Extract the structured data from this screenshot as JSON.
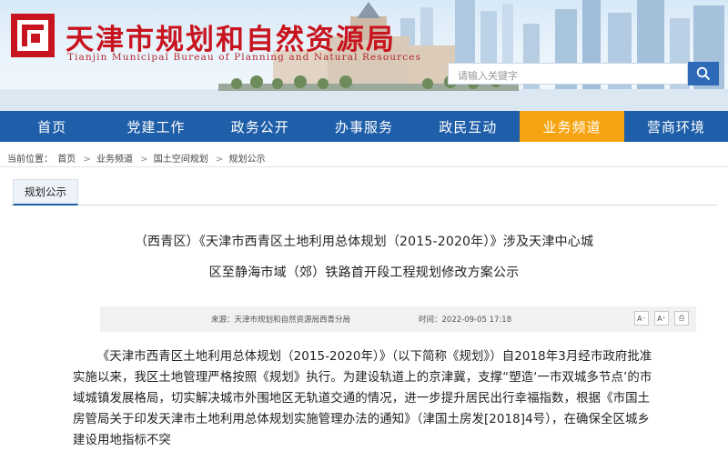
{
  "header": {
    "title": "天津市规划和自然资源局",
    "subtitle": "Tianjin Municipal Bureau of Planning and Natural Resources",
    "search_placeholder": "请输入关键字",
    "search_button_icon": "search-icon",
    "logo_icon": "bureau-logo-icon",
    "brand_color": "#c8141e"
  },
  "nav": {
    "items": [
      {
        "label": "首页"
      },
      {
        "label": "党建工作"
      },
      {
        "label": "政务公开"
      },
      {
        "label": "办事服务"
      },
      {
        "label": "政民互动"
      },
      {
        "label": "业务频道",
        "active": true
      },
      {
        "label": "营商环境"
      }
    ],
    "bg_color": "#1f5ea8",
    "active_color": "#f5a30f"
  },
  "breadcrumb": {
    "prefix": "当前位置：",
    "items": [
      "首页",
      "业务频道",
      "国土空间规划",
      "规划公示"
    ],
    "separator": ">"
  },
  "section_tab": "规划公示",
  "article": {
    "title_line1": "（西青区）《天津市西青区土地利用总体规划（2015-2020年）》涉及天津中心城",
    "title_line2": "区至静海市域（郊）铁路首开段工程规划修改方案公示",
    "source": "来源：天津市规划和自然资源局西青分局",
    "time": "时间：2022-09-05 17:18",
    "tools": [
      {
        "label": "A⁻",
        "icon": "font-decrease-icon"
      },
      {
        "label": "A⁺",
        "icon": "font-increase-icon"
      },
      {
        "label": "⎙",
        "icon": "print-icon"
      }
    ],
    "body": "《天津市西青区土地利用总体规划（2015-2020年）》（以下简称《规划》）自2018年3月经市政府批准实施以来，我区土地管理严格按照《规划》执行。为建设轨道上的京津冀，支撑“塑造‘一市双城多节点’的市域城镇发展格局，切实解决城市外围地区无轨道交通的情况，进一步提升居民出行幸福指数，根据《市国土房管局关于印发天津市土地利用总体规划实施管理办法的通知》（津国土房发[2018]4号），在确保全区城乡建设用地指标不突"
  }
}
